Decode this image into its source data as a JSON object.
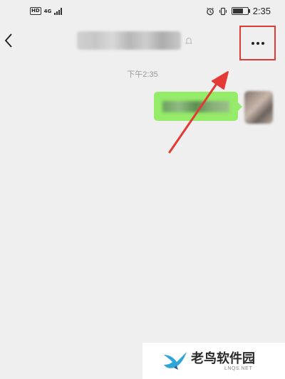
{
  "status_bar": {
    "network_badge": "HD",
    "network_type": "4G",
    "time": "2:35",
    "icons": [
      "alarm-icon",
      "vibrate-icon",
      "battery-icon"
    ]
  },
  "nav": {
    "back_icon": "chevron-left-icon",
    "more_icon": "more-dots-icon",
    "highlight_color": "#e03a35"
  },
  "chat": {
    "timestamp": "下午2:35",
    "bubble_color": "#95ec69"
  },
  "annotation": {
    "arrow_color": "#e53935"
  },
  "watermark": {
    "site_name": "老鸟软件园",
    "domain": "LNQS.NET"
  }
}
